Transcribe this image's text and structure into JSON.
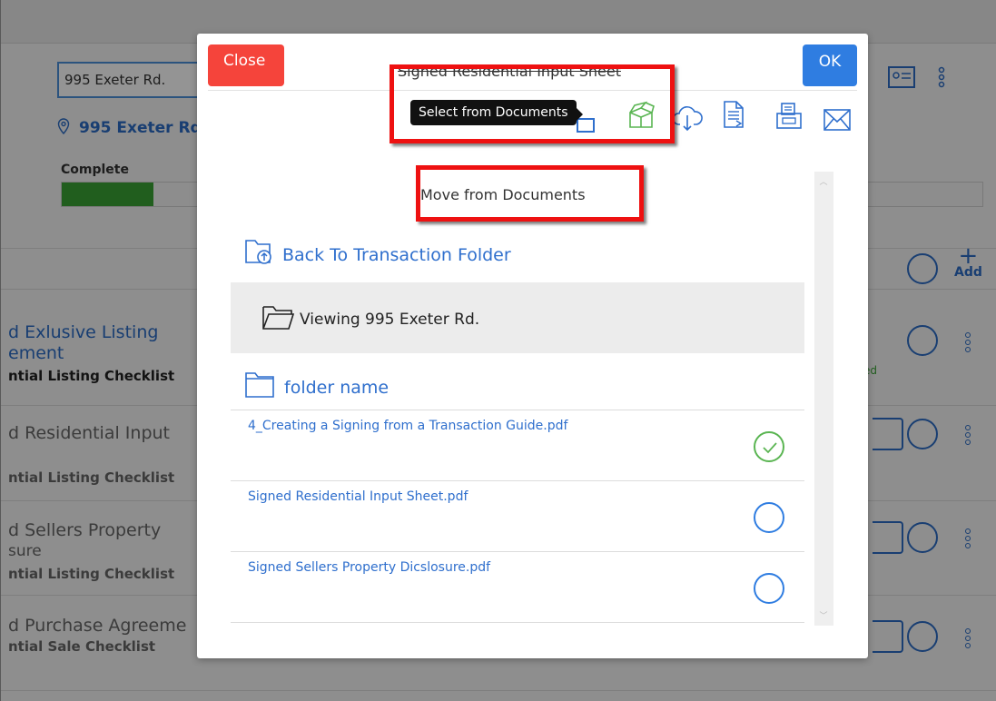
{
  "background": {
    "address_value": "995 Exeter Rd.",
    "location_link": "995 Exeter Rd.",
    "progress_label": "Complete",
    "progress_fraction": 0.1,
    "add_label": "Add",
    "rows": [
      {
        "title_line1": "d Exlusive Listing",
        "title_line2": "ement",
        "subtitle": "ntial Listing Checklist",
        "status": "ed"
      },
      {
        "title_line1": "d Residential Input",
        "title_line2": "",
        "subtitle": "ntial Listing Checklist"
      },
      {
        "title_line1": "d Sellers Property",
        "title_line2": "sure",
        "subtitle": "ntial Listing Checklist"
      },
      {
        "title_line1": "d Purchase Agreeme",
        "title_line2": "",
        "subtitle": "ntial Sale Checklist"
      }
    ]
  },
  "modal": {
    "close_label": "Close",
    "ok_label": "OK",
    "title": "Signed Residential Input Sheet",
    "tooltip": "Select from Documents",
    "section_heading": "Move from Documents",
    "back_link": "Back To Transaction Folder",
    "current_folder": "Viewing 995 Exeter Rd.",
    "folder_name": "folder name",
    "files": [
      {
        "name": "4_Creating a Signing from a Transaction Guide.pdf",
        "selected": true
      },
      {
        "name": "Signed Residential Input Sheet.pdf",
        "selected": false
      },
      {
        "name": "Signed Sellers Property Dicslosure.pdf",
        "selected": false
      }
    ],
    "toolbar_icons": [
      "document-icon",
      "open-box-icon",
      "cloud-download-icon",
      "file-list-icon",
      "fax-icon",
      "envelope-icon"
    ],
    "colors": {
      "accent": "#2f7de1",
      "danger": "#f5443b",
      "success": "#5ab552",
      "highlight": "#ee1111"
    }
  }
}
